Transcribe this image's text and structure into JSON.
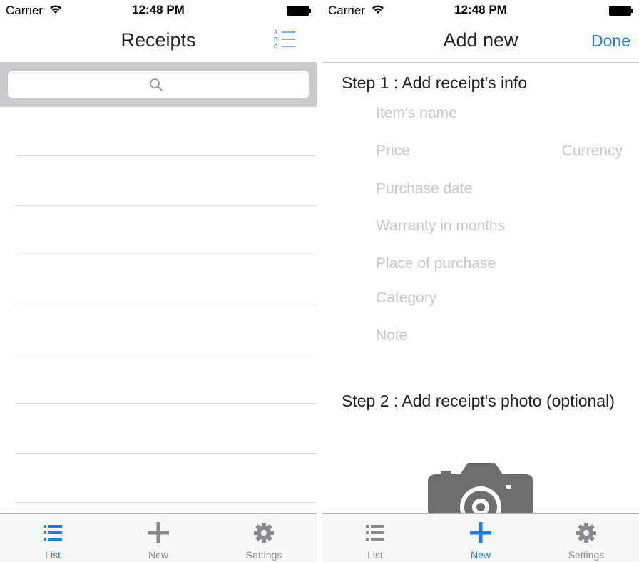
{
  "status": {
    "carrier": "Carrier",
    "time": "12:48 PM"
  },
  "list_screen": {
    "title": "Receipts",
    "row_count": 8
  },
  "add_screen": {
    "title": "Add new",
    "done_label": "Done",
    "step1": "Step 1 : Add receipt's info",
    "fields": {
      "item_name": "Item's name",
      "price": "Price",
      "currency": "Currency",
      "purchase_date": "Purchase date",
      "warranty": "Warranty in months",
      "place": "Place of purchase",
      "category": "Category",
      "note": "Note"
    },
    "step2": "Step 2 : Add receipt's photo (optional)"
  },
  "tabs": [
    {
      "label": "List",
      "icon": "list-icon"
    },
    {
      "label": "New",
      "icon": "plus-icon"
    },
    {
      "label": "Settings",
      "icon": "gear-icon"
    }
  ],
  "colors": {
    "accent": "#1a7de8",
    "inactive": "#8a8a8f",
    "placeholder": "#c7c7cd",
    "search_bg": "#c9c9ce"
  }
}
